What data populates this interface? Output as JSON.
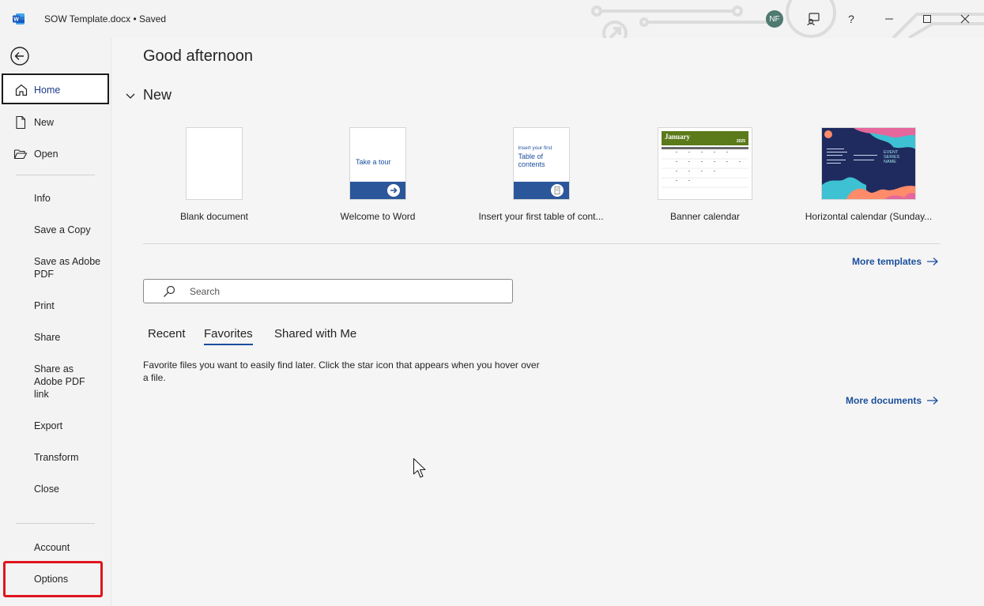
{
  "window": {
    "doc_title": "SOW Template.docx • Saved",
    "avatar_initials": "NF",
    "help_label": "?"
  },
  "nav": {
    "items": [
      {
        "label": "Home",
        "icon": "home-icon"
      },
      {
        "label": "New",
        "icon": "new-document-icon"
      },
      {
        "label": "Open",
        "icon": "folder-open-icon"
      },
      {
        "label": "Info"
      },
      {
        "label": "Save a Copy"
      },
      {
        "label": "Save as Adobe PDF"
      },
      {
        "label": "Print"
      },
      {
        "label": "Share"
      },
      {
        "label": "Share as Adobe PDF link"
      },
      {
        "label": "Export"
      },
      {
        "label": "Transform"
      },
      {
        "label": "Close"
      },
      {
        "label": "Account"
      },
      {
        "label": "Options"
      }
    ]
  },
  "main": {
    "greeting": "Good afternoon",
    "new_section": "New",
    "templates": [
      {
        "name": "Blank document"
      },
      {
        "name": "Welcome to Word",
        "thumb_text": "Take a tour"
      },
      {
        "name": "Insert your first table of cont...",
        "thumb_small": "Insert your first",
        "thumb_big": "Table of contents"
      },
      {
        "name": "Banner calendar",
        "thumb_text": "January",
        "thumb_year": "2025"
      },
      {
        "name": "Horizontal calendar (Sunday...",
        "thumb_text": "EVENT SERIES NAME"
      }
    ],
    "more_templates": "More templates",
    "search_placeholder": "Search",
    "tabs": [
      "Recent",
      "Favorites",
      "Shared with Me"
    ],
    "active_tab": "Favorites",
    "favorites_message": "Favorite files you want to easily find later. Click the star icon that appears when you hover over a file.",
    "more_documents": "More documents"
  },
  "colors": {
    "accent": "#1b4f9c",
    "highlight_box": "#e0141e",
    "avatar_bg": "#4e7a6f"
  }
}
